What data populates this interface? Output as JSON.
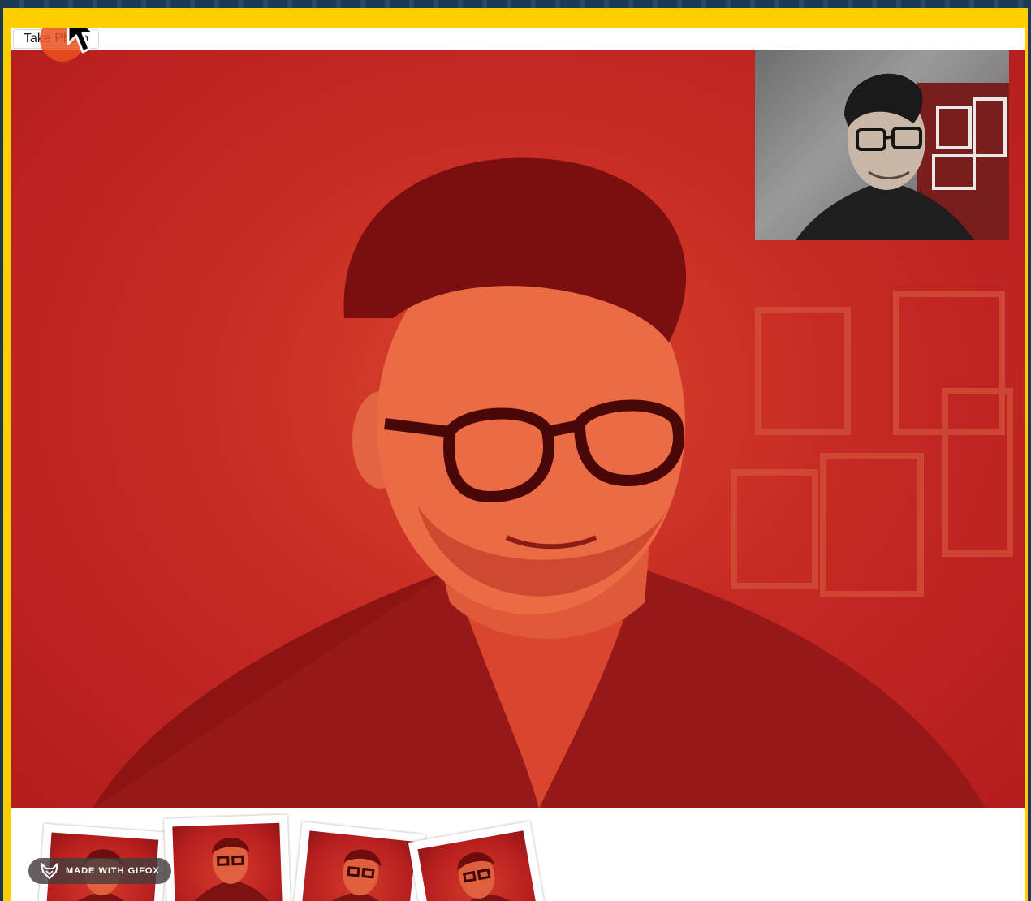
{
  "controls": {
    "take_photo_label": "Take Photo"
  },
  "badge": {
    "label": "MADE WITH GIFOX"
  },
  "icons": {
    "cursor": "arrow-cursor-icon",
    "gifox": "fox-icon"
  },
  "colors": {
    "frame": "#ffce00",
    "video_filter": "#c72a24"
  },
  "photos": [
    {
      "name": "photo-1"
    },
    {
      "name": "photo-2"
    },
    {
      "name": "photo-3"
    },
    {
      "name": "photo-4"
    }
  ]
}
